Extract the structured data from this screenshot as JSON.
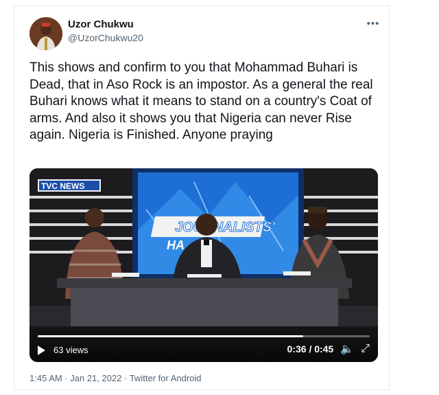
{
  "tweet": {
    "display_name": "Uzor Chukwu",
    "handle": "@UzorChukwu20",
    "more_label": "•••",
    "text": "This shows and confirm to you that Mohammad Buhari is Dead, that in Aso Rock is an impostor. As a general the real Buhari knows what it means to stand on a country's Coat of arms. And also it shows you that Nigeria can never Rise again. Nigeria is Finished. Anyone praying",
    "metadata": "1:45 AM · Jan 21, 2022 · Twitter for Android"
  },
  "video": {
    "channel_logo": "TVC NEWS",
    "backdrop_text": "JOURNALISTS'",
    "backdrop_text_partial": "HA",
    "views": "63 views",
    "time": "0:36 / 0:45",
    "progress": 0.8,
    "icons": [
      "play-icon",
      "volume-icon",
      "fullscreen-icon"
    ],
    "volume_glyph": "🔈",
    "fullscreen_glyph": "⤢"
  },
  "colors": {
    "text": "#0f1419",
    "secondary": "#536471",
    "tvc_blue": "#1d4fa8",
    "backdrop_blue": "#1d6fd6"
  }
}
